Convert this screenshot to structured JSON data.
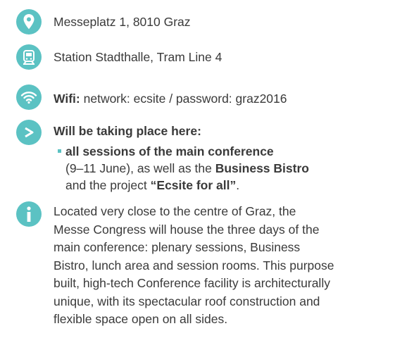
{
  "address": "Messeplatz 1, 8010 Graz",
  "transport": "Station Stadthalle, Tram Line 4",
  "wifi": {
    "label": "Wifi:",
    "text": " network: ecsite / password: graz2016"
  },
  "events": {
    "heading": "Will be taking place here:",
    "bullet_bold": "all sessions of the main conference",
    "line2_pre": "(9–11 June), as well as the ",
    "line2_bold": "Business Bistro",
    "line3_pre": "and the project ",
    "line3_bold": "“Ecsite for all”",
    "line3_post": "."
  },
  "info": {
    "lines": [
      "Located very close to the centre of Graz, the",
      "Messe Congress will house the three days of the",
      "main conference: plenary sessions, Business",
      "Bistro, lunch area and session rooms. This purpose",
      "built, high-tech Conference facility is architecturally",
      "unique, with its spectacular roof construction and",
      "flexible space open on all sides."
    ]
  },
  "colors": {
    "accent": "#5bc2c3",
    "text": "#3a3a3a"
  },
  "icons": [
    "location-pin-icon",
    "tram-icon",
    "wifi-icon",
    "arrow-right-icon",
    "info-icon"
  ]
}
